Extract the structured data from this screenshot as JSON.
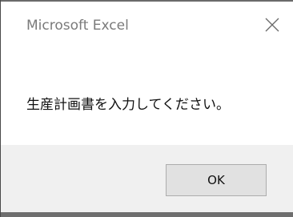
{
  "window": {
    "title": "Microsoft Excel",
    "close_icon": "close-icon"
  },
  "dialog": {
    "message": "生産計画書を入力してください。",
    "ok_label": "OK"
  },
  "colors": {
    "title_text": "#7a7a7a",
    "message_text": "#111111",
    "footer_background": "#f0f0f0",
    "button_background": "#e1e1e1",
    "button_border": "#adadad"
  }
}
